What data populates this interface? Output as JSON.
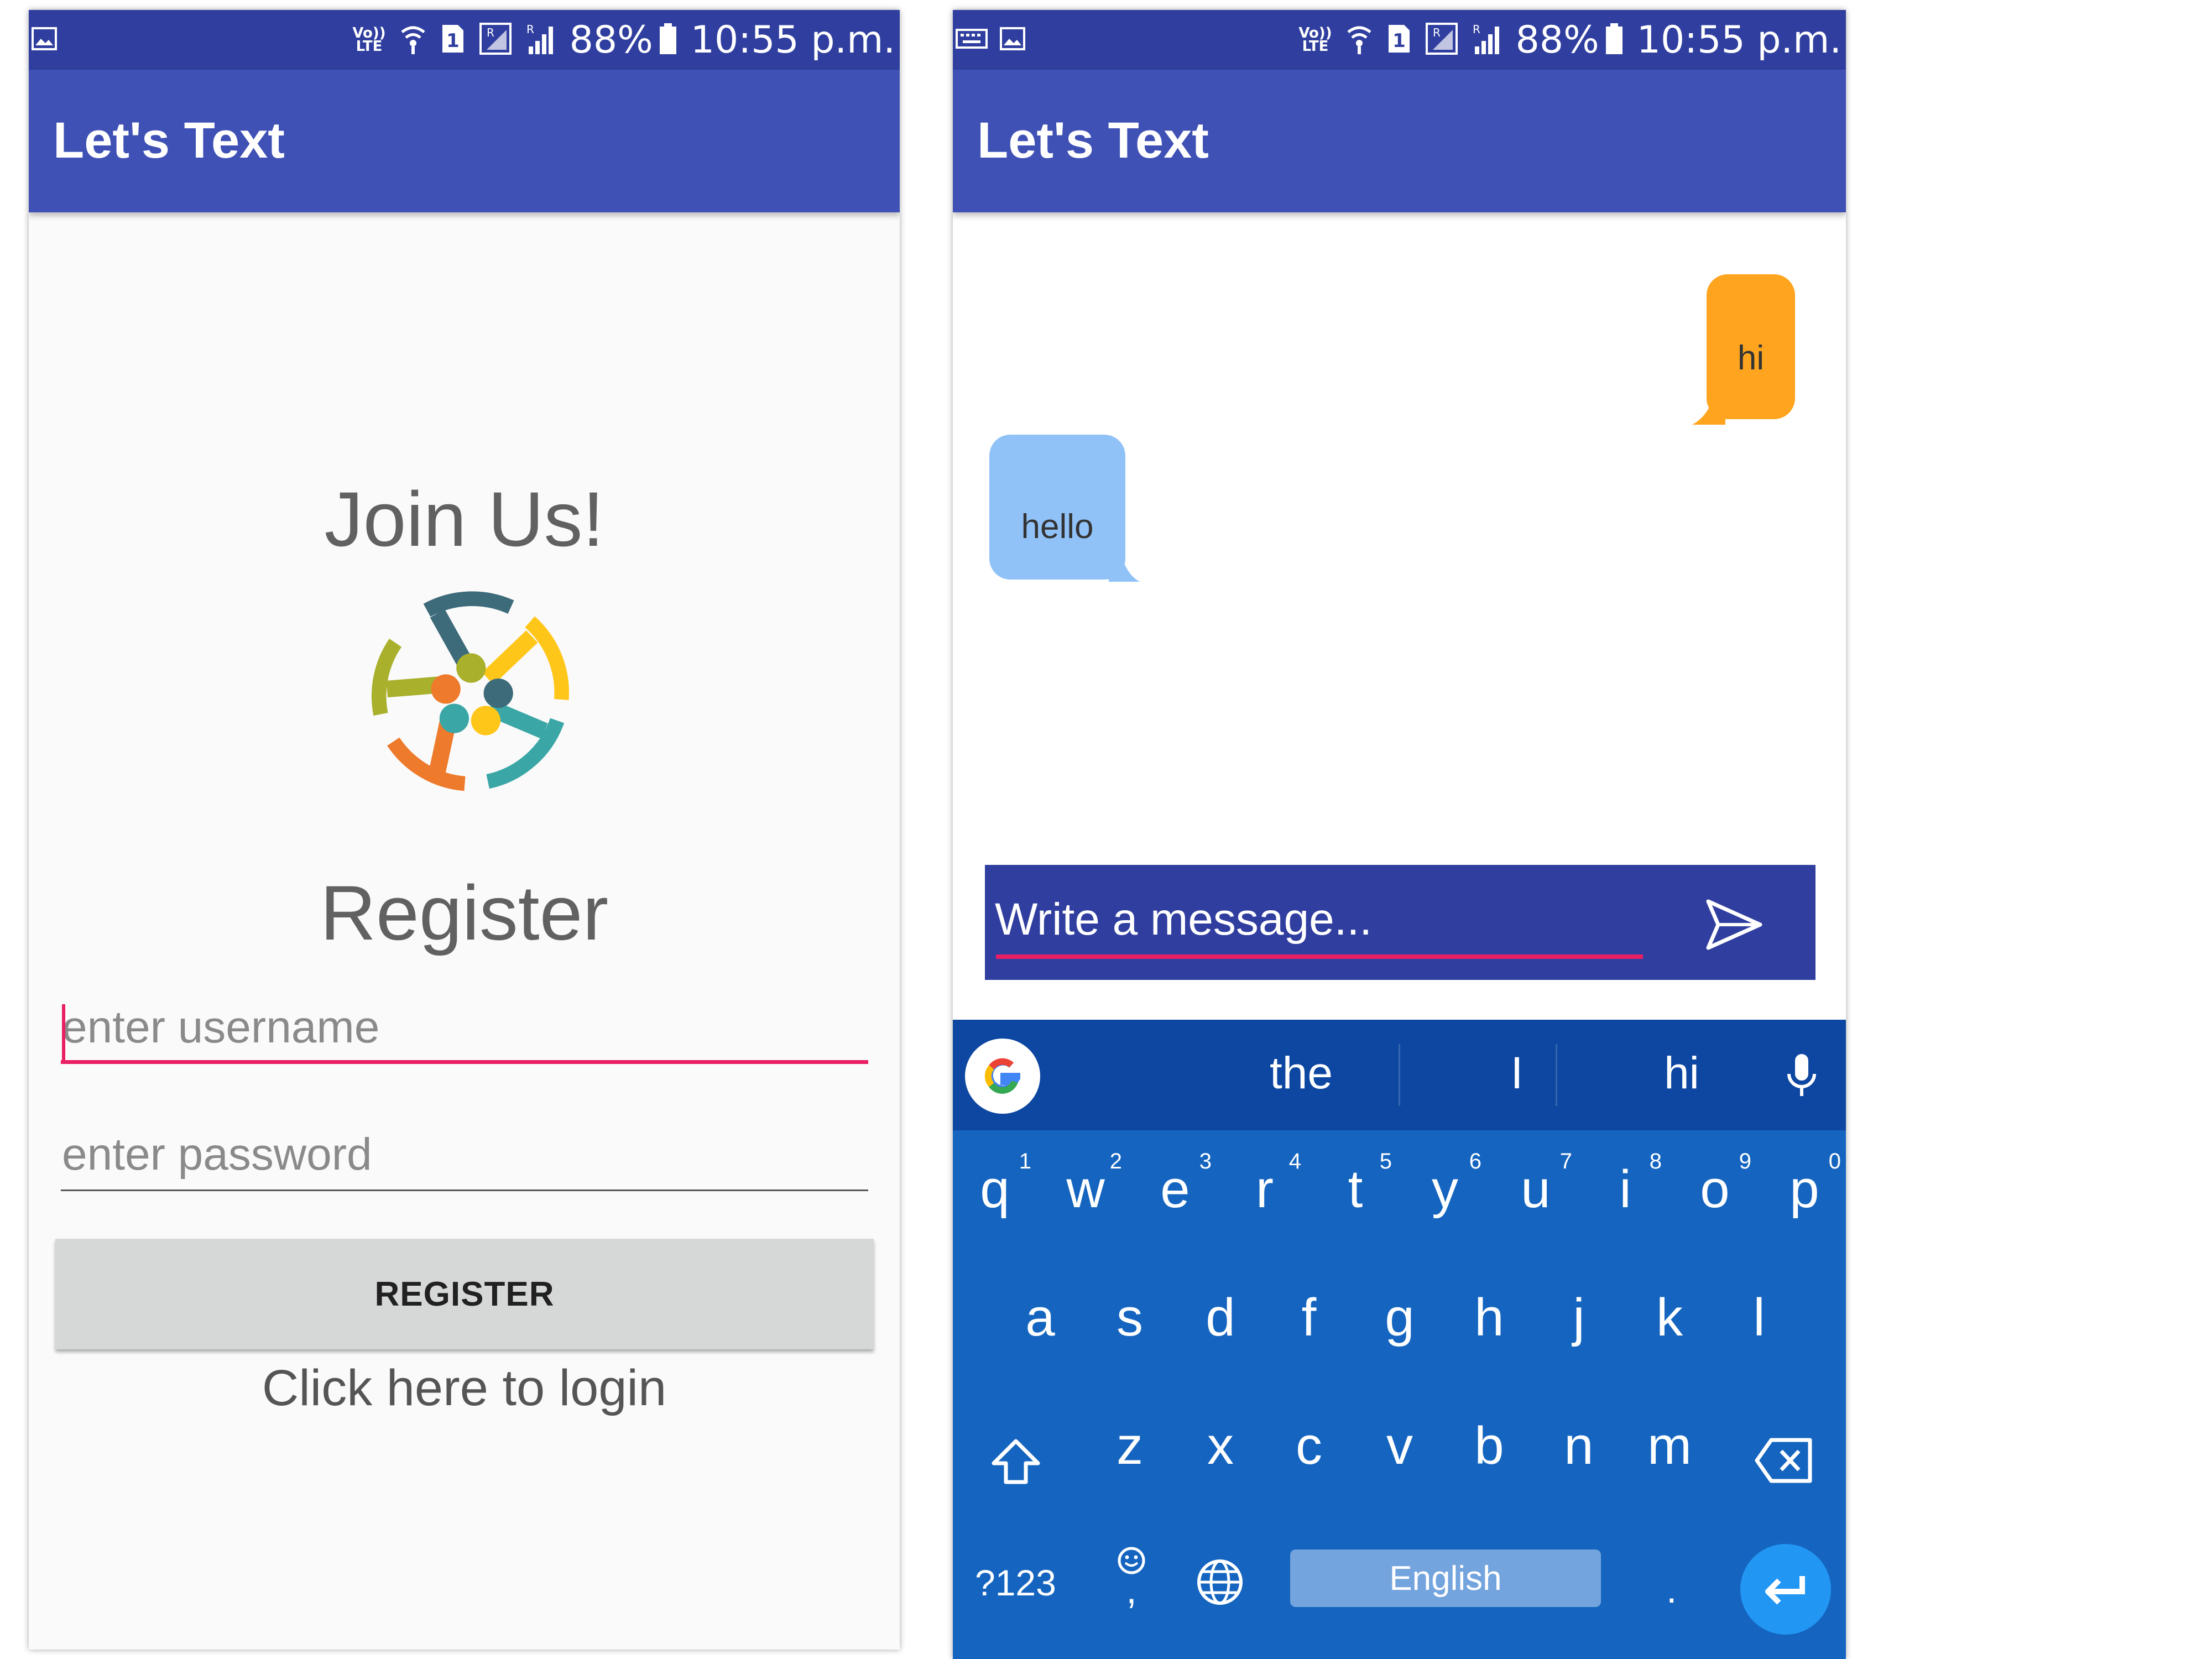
{
  "status_bar": {
    "battery": "88%",
    "time": "10:55 p.m.",
    "volte_top": "Vo))",
    "volte_bottom": "LTE",
    "sim": "1",
    "signal_r": "R"
  },
  "register_screen": {
    "app_title": "Let's Text",
    "join_title": "Join Us!",
    "register_title": "Register",
    "username_placeholder": "enter username",
    "password_placeholder": "enter password",
    "register_button": "REGISTER",
    "login_link": "Click here to login"
  },
  "chat_screen": {
    "app_title": "Let's Text",
    "messages": [
      {
        "text": "hi",
        "side": "right",
        "color": "#ffa41f"
      },
      {
        "text": "hello",
        "side": "left",
        "color": "#90c2f8"
      }
    ],
    "composer_placeholder": "Write a message..."
  },
  "keyboard": {
    "suggestions": [
      "the",
      "I",
      "hi"
    ],
    "row1": [
      {
        "ch": "q",
        "num": "1"
      },
      {
        "ch": "w",
        "num": "2"
      },
      {
        "ch": "e",
        "num": "3"
      },
      {
        "ch": "r",
        "num": "4"
      },
      {
        "ch": "t",
        "num": "5"
      },
      {
        "ch": "y",
        "num": "6"
      },
      {
        "ch": "u",
        "num": "7"
      },
      {
        "ch": "i",
        "num": "8"
      },
      {
        "ch": "o",
        "num": "9"
      },
      {
        "ch": "p",
        "num": "0"
      }
    ],
    "row2": [
      "a",
      "s",
      "d",
      "f",
      "g",
      "h",
      "j",
      "k",
      "l"
    ],
    "row3": [
      "z",
      "x",
      "c",
      "v",
      "b",
      "n",
      "m"
    ],
    "symbols_key": "?123",
    "emoji_comma": ",",
    "period": ".",
    "space_label": "English"
  },
  "colors": {
    "status_bar": "#303f9f",
    "app_bar": "#3f51b5",
    "accent": "#e91e63",
    "keyboard": "#1565c0",
    "suggestion_bar": "#0d47a1"
  }
}
